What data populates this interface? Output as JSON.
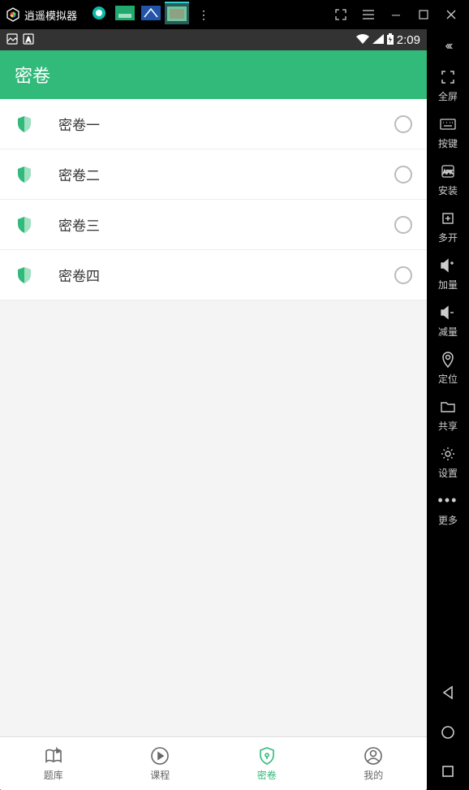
{
  "emulator": {
    "title": "逍遥模拟器"
  },
  "statusBar": {
    "time": "2:09"
  },
  "app": {
    "headerTitle": "密卷"
  },
  "list": [
    {
      "label": "密卷一"
    },
    {
      "label": "密卷二"
    },
    {
      "label": "密卷三"
    },
    {
      "label": "密卷四"
    }
  ],
  "bottomNav": [
    {
      "label": "题库"
    },
    {
      "label": "课程"
    },
    {
      "label": "密卷"
    },
    {
      "label": "我的"
    }
  ],
  "sidebar": [
    {
      "label": "全屏"
    },
    {
      "label": "按键"
    },
    {
      "label": "安装"
    },
    {
      "label": "多开"
    },
    {
      "label": "加量"
    },
    {
      "label": "减量"
    },
    {
      "label": "定位"
    },
    {
      "label": "共享"
    },
    {
      "label": "设置"
    },
    {
      "label": "更多"
    }
  ]
}
